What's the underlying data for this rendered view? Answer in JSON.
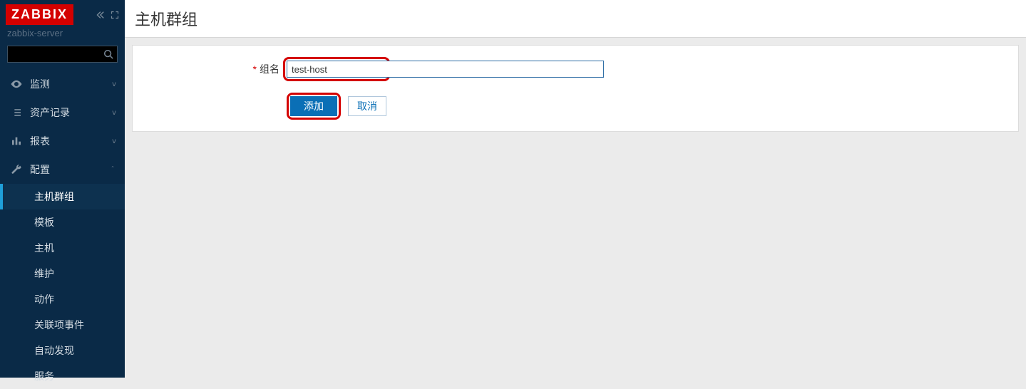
{
  "sidebar": {
    "logo": "ZABBIX",
    "server_name": "zabbix-server",
    "nav": [
      {
        "label": "监测",
        "icon": "eye",
        "expanded": false
      },
      {
        "label": "资产记录",
        "icon": "list",
        "expanded": false
      },
      {
        "label": "报表",
        "icon": "bar-chart",
        "expanded": false
      },
      {
        "label": "配置",
        "icon": "wrench",
        "expanded": true,
        "children": [
          {
            "label": "主机群组",
            "active": true
          },
          {
            "label": "模板",
            "active": false
          },
          {
            "label": "主机",
            "active": false
          },
          {
            "label": "维护",
            "active": false
          },
          {
            "label": "动作",
            "active": false
          },
          {
            "label": "关联项事件",
            "active": false
          },
          {
            "label": "自动发现",
            "active": false
          },
          {
            "label": "服务",
            "active": false
          }
        ]
      }
    ]
  },
  "page": {
    "title": "主机群组"
  },
  "form": {
    "group_name_label": "组名",
    "group_name_value": "test-host",
    "add_button": "添加",
    "cancel_button": "取消"
  }
}
